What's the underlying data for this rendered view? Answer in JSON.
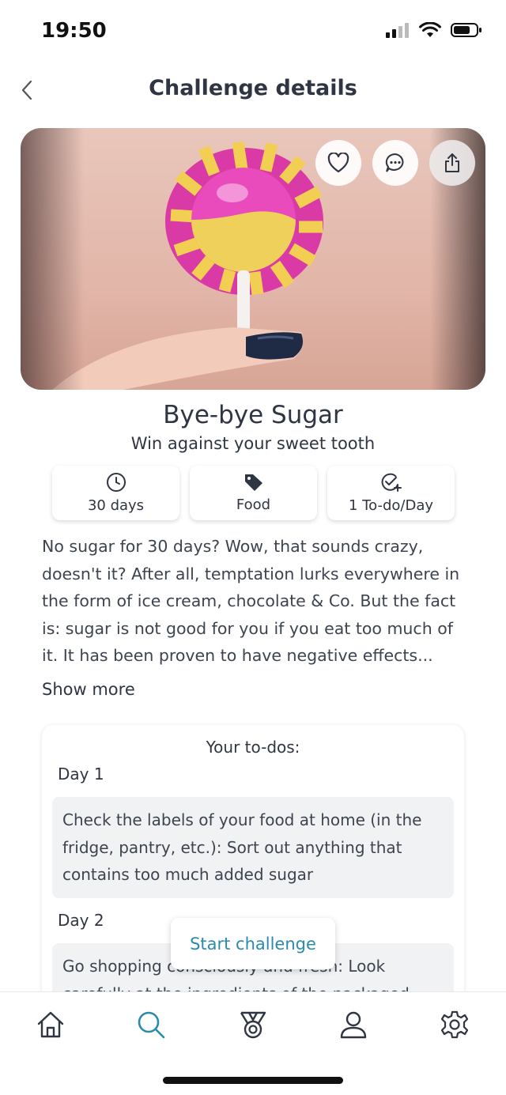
{
  "status": {
    "time": "19:50"
  },
  "header": {
    "title": "Challenge details"
  },
  "challenge": {
    "title": "Bye-bye Sugar",
    "subtitle": "Win against your sweet tooth",
    "chips": [
      {
        "label": "30 days",
        "icon": "clock-icon"
      },
      {
        "label": "Food",
        "icon": "tag-icon"
      },
      {
        "label": "1 To-do/Day",
        "icon": "check-plus-icon"
      }
    ],
    "description": "No sugar for 30 days? Wow, that sounds crazy, doesn't it? After all, temptation lurks everywhere in the form of ice cream, chocolate & Co. But the fact is: sugar is not good for you if you eat too much of it. It has been proven to have negative effects...",
    "show_more": "Show more"
  },
  "todos": {
    "title": "Your to-dos:",
    "days": [
      {
        "label": "Day 1",
        "text": "Check the labels of your food at home (in the fridge, pantry, etc.): Sort out anything that contains too much added sugar"
      },
      {
        "label": "Day 2",
        "text": "Go shopping consciously and fresh: Look carefully at the ingredients of the packaged"
      }
    ]
  },
  "actions": {
    "start": "Start challenge"
  },
  "tabs": [
    {
      "icon": "home-icon",
      "active": false
    },
    {
      "icon": "search-icon",
      "active": true
    },
    {
      "icon": "medal-icon",
      "active": false
    },
    {
      "icon": "profile-icon",
      "active": false
    },
    {
      "icon": "settings-icon",
      "active": false
    }
  ],
  "colors": {
    "accent": "#2a8bad",
    "text": "#2f3542",
    "card_bg": "#f1f2f4"
  }
}
